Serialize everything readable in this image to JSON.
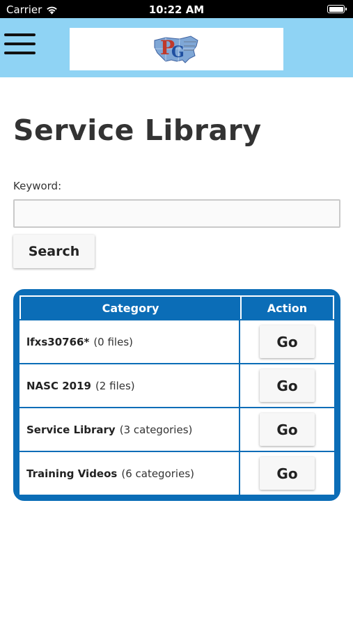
{
  "status_bar": {
    "carrier": "Carrier",
    "time": "10:22 AM"
  },
  "header": {
    "logo_name": "usa-map-logo"
  },
  "page": {
    "title": "Service Library"
  },
  "search": {
    "label": "Keyword:",
    "value": "",
    "placeholder": "",
    "button_label": "Search"
  },
  "table": {
    "headers": [
      "Category",
      "Action"
    ],
    "rows": [
      {
        "name": "lfxs30766*",
        "count": "(0 files)",
        "action": "Go"
      },
      {
        "name": "NASC 2019",
        "count": "(2 files)",
        "action": "Go"
      },
      {
        "name": "Service Library",
        "count": "(3 categories)",
        "action": "Go"
      },
      {
        "name": "Training Videos",
        "count": "(6 categories)",
        "action": "Go"
      }
    ]
  },
  "colors": {
    "header_bg": "#8fd3f4",
    "table_border": "#0b6db7"
  }
}
